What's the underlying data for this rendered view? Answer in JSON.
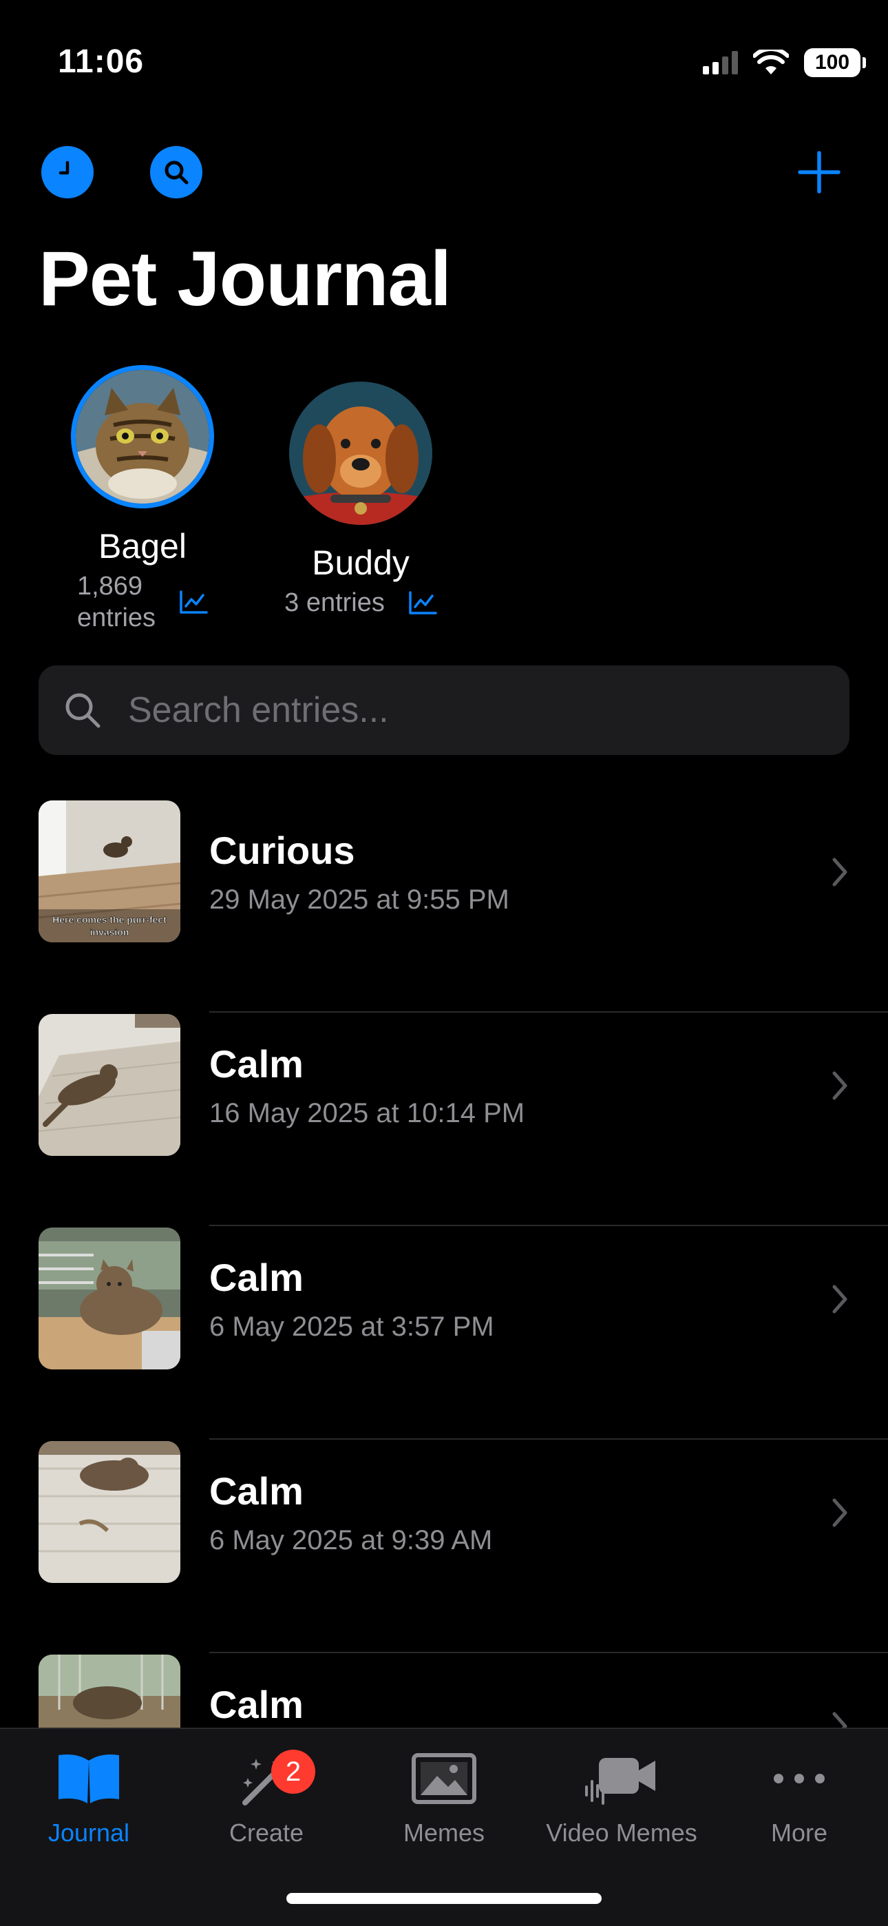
{
  "status_bar": {
    "time": "11:06",
    "battery": "100"
  },
  "header": {
    "title": "Pet Journal"
  },
  "pets": [
    {
      "name": "Bagel",
      "entries_count": "1,869",
      "entries_word": "entries"
    },
    {
      "name": "Buddy",
      "entries_label": "3 entries"
    }
  ],
  "search": {
    "placeholder": "Search entries..."
  },
  "entries": [
    {
      "title": "Curious",
      "date": "29 May 2025 at 9:55 PM",
      "caption": "Here comes the purr-fect invasion"
    },
    {
      "title": "Calm",
      "date": "16 May 2025 at 10:14 PM"
    },
    {
      "title": "Calm",
      "date": "6 May 2025 at 3:57 PM"
    },
    {
      "title": "Calm",
      "date": "6 May 2025 at 9:39 AM"
    },
    {
      "title": "Calm",
      "date": ""
    }
  ],
  "tabs": [
    {
      "label": "Journal"
    },
    {
      "label": "Create",
      "badge": "2"
    },
    {
      "label": "Memes"
    },
    {
      "label": "Video Memes"
    },
    {
      "label": "More"
    }
  ],
  "colors": {
    "accent": "#0a84ff",
    "badge": "#ff3b30",
    "background": "#000000"
  }
}
